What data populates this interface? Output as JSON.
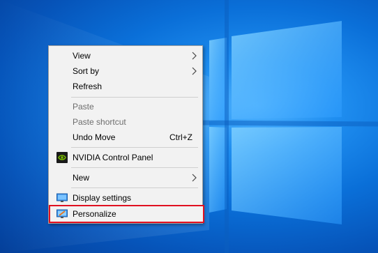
{
  "context_menu": {
    "items": [
      {
        "label": "View",
        "submenu": true
      },
      {
        "label": "Sort by",
        "submenu": true
      },
      {
        "label": "Refresh"
      },
      {
        "label": "Paste",
        "disabled": true
      },
      {
        "label": "Paste shortcut",
        "disabled": true
      },
      {
        "label": "Undo Move",
        "shortcut": "Ctrl+Z"
      },
      {
        "label": "NVIDIA Control Panel",
        "icon": "nvidia-icon"
      },
      {
        "label": "New",
        "submenu": true
      },
      {
        "label": "Display settings",
        "icon": "display-icon"
      },
      {
        "label": "Personalize",
        "icon": "personalize-icon",
        "highlighted": true
      }
    ]
  },
  "colors": {
    "highlight_border": "#e01020",
    "menu_background": "#f2f2f2",
    "desktop_blue": "#0a6fd8"
  }
}
